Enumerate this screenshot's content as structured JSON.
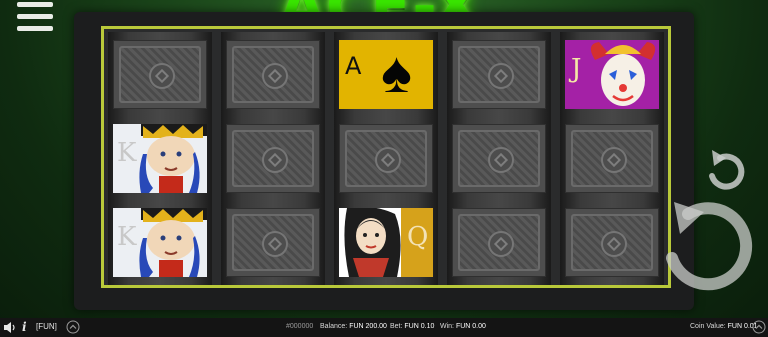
{
  "game": {
    "logo_text": "ACE-X"
  },
  "reels": [
    [
      "card-back",
      "king",
      "king"
    ],
    [
      "card-back",
      "card-back",
      "card-back"
    ],
    [
      "ace",
      "card-back",
      "queen"
    ],
    [
      "card-back",
      "card-back",
      "card-back"
    ],
    [
      "jester",
      "card-back",
      "card-back"
    ]
  ],
  "symbols": {
    "ace": {
      "rank": "A",
      "suit": "♠",
      "color": "#e2b400"
    },
    "king": {
      "rank": "K"
    },
    "queen": {
      "rank": "Q"
    },
    "jester": {
      "rank": "J",
      "color": "#a421a6"
    }
  },
  "footer": {
    "mode": "[FUN]",
    "round_id": "#000000",
    "balance_label": "Balance:",
    "balance_value": "FUN 200.00",
    "bet_label": "Bet:",
    "bet_value": "FUN 0.10",
    "win_label": "Win:",
    "win_value": "FUN 0.00",
    "coin_label": "Coin Value:",
    "coin_value": "FUN 0.01"
  },
  "colors": {
    "frame": "#b9c93a",
    "logo": "#39e500",
    "background": "#1d4a1c"
  }
}
